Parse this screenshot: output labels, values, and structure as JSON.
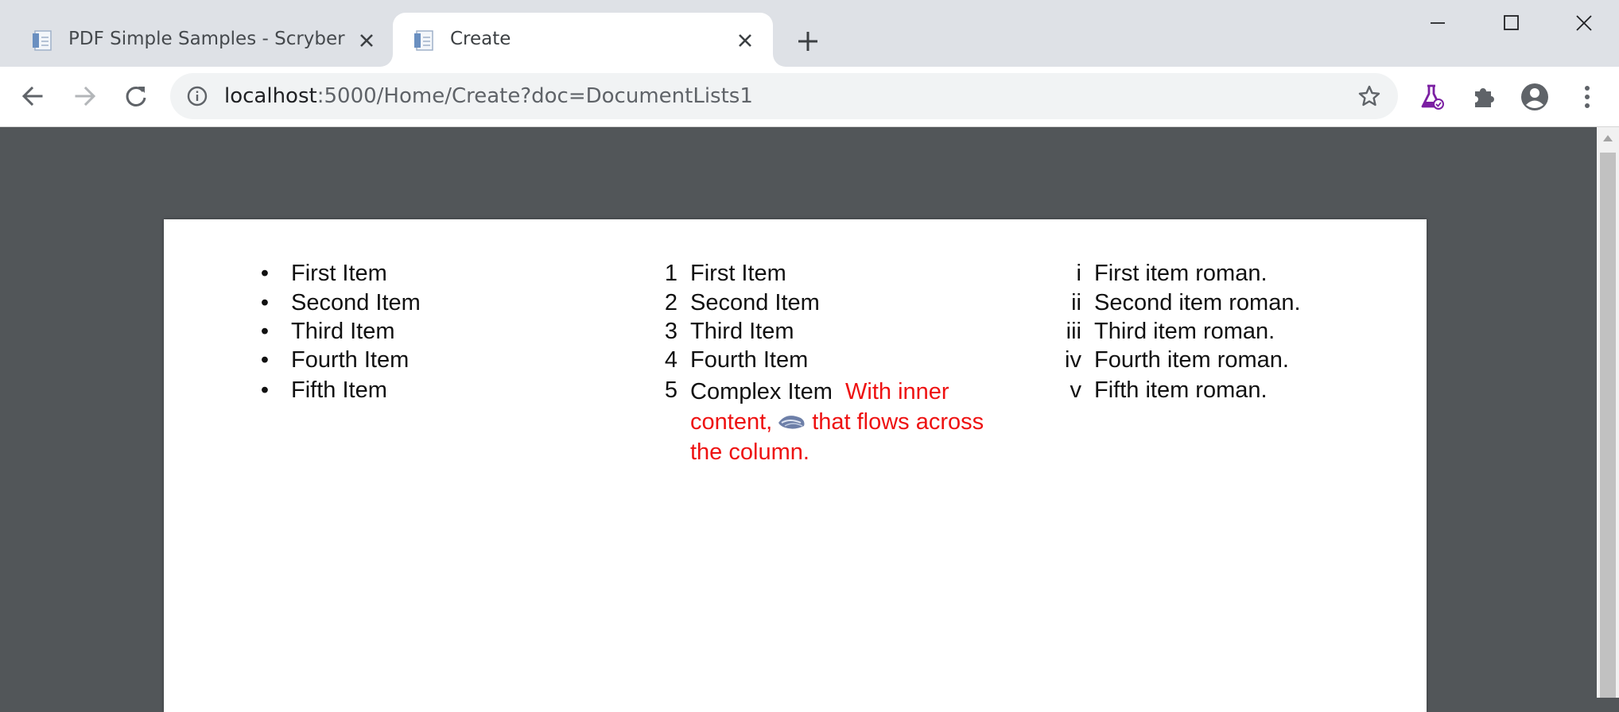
{
  "browser": {
    "tabs": [
      {
        "title": "PDF Simple Samples - Scryber",
        "active": false
      },
      {
        "title": "Create",
        "active": true
      }
    ],
    "address": {
      "host": "localhost",
      "path": ":5000/Home/Create?doc=DocumentLists1"
    },
    "icons": {
      "back": "arrow-left-icon",
      "forward": "arrow-right-icon",
      "reload": "reload-icon",
      "info": "info-icon",
      "star": "star-icon",
      "lab": "flask-icon",
      "extensions": "puzzle-icon",
      "profile": "account-icon",
      "menu": "more-vert-icon"
    },
    "colors": {
      "tabstrip": "#dee1e6",
      "viewer": "#525659",
      "inner_text": "#ee1111",
      "lab_icon": "#7b1fa2"
    }
  },
  "document": {
    "bulleted_list": {
      "marker": "•",
      "items": [
        "First Item",
        "Second Item",
        "Third Item",
        "Fourth Item",
        "Fifth Item"
      ]
    },
    "numbered_list": {
      "markers": [
        "1",
        "2",
        "3",
        "4",
        "5"
      ],
      "items": [
        "First Item",
        "Second Item",
        "Third Item",
        "Fourth Item"
      ],
      "complex_item": {
        "lead": "Complex Item",
        "inner_part1": "With inner content,",
        "inner_part2": "that flows across the column.",
        "image": "leaf-image-icon"
      }
    },
    "roman_list": {
      "markers": [
        "i",
        "ii",
        "iii",
        "iv",
        "v"
      ],
      "items": [
        "First item roman.",
        "Second item roman.",
        "Third item roman.",
        "Fourth item roman.",
        "Fifth item roman."
      ]
    }
  }
}
